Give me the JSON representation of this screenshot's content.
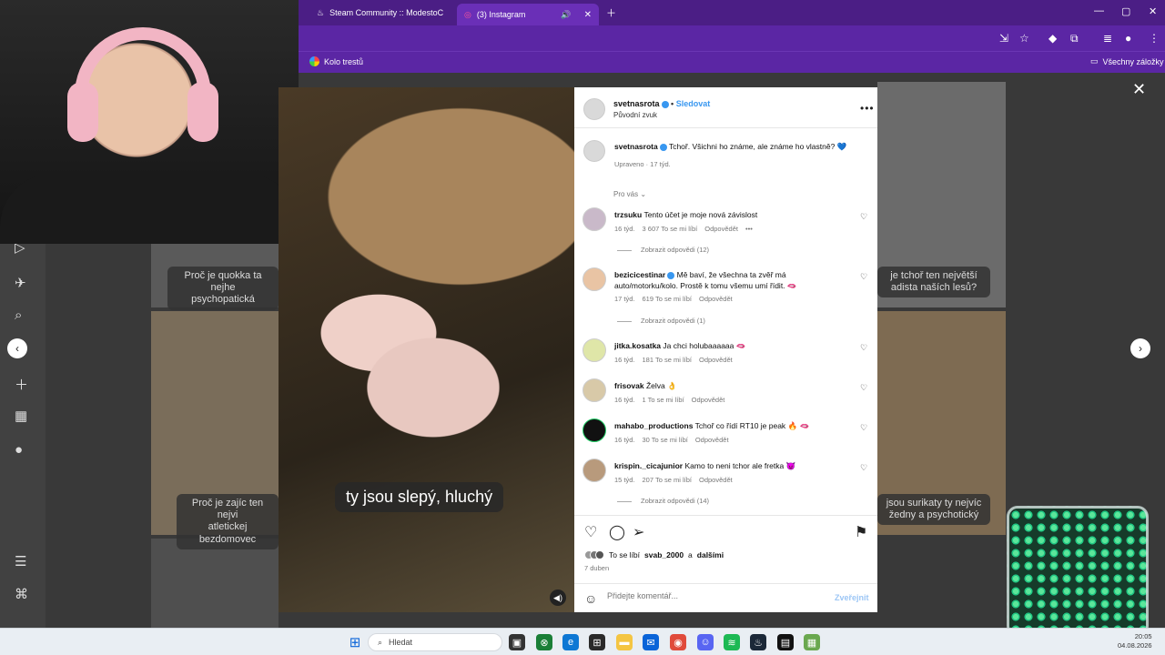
{
  "browser": {
    "tabs": [
      {
        "title": "Steam Community :: ModestoC",
        "icon": "steam-icon",
        "active": false
      },
      {
        "title": "(3) Instagram",
        "icon": "instagram-icon",
        "active": true
      }
    ],
    "bookmarks": [
      {
        "label": "Kolo trestů"
      }
    ],
    "bookmarks_all": "Všechny záložky"
  },
  "backdrop": {
    "captions": [
      "Proč je quokka ta nejhe\npsychopatická",
      "je tchoř ten největší\nadista naších lesů?",
      "Proč je zajíc ten nejvi\natletickej bezdomovec",
      "jsou surikaty ty nejvíc\nžedny a psychotický"
    ]
  },
  "post": {
    "author": "svetnasrota",
    "follow_label": "Sledovat",
    "sub": "Původní zvuk",
    "caption": "Tchoř. Všichni ho známe, ale známe ho vlastně? 💙",
    "caption_meta": "Upraveno · 17 týd.",
    "filter_label": "Pro vás",
    "subtitle": "ty jsou slepý, hluchý",
    "likes_prefix": "To se líbí",
    "likes_user": "svab_2000",
    "likes_and": "a",
    "likes_more": "dalšími",
    "date": "7 duben",
    "comment_placeholder": "Přidejte komentář...",
    "post_label": "Zveřejnit"
  },
  "comments": [
    {
      "user": "trzsuku",
      "text": "Tento účet je moje nová závislost",
      "age": "16 týd.",
      "likes": "3 607 To se mi líbí",
      "reply": "Odpovědět",
      "replies": "Zobrazit odpovědi (12)"
    },
    {
      "user": "bezicicestinar",
      "text": "Mě baví, že všechna ta zvěř má auto/motorku/kolo. Prostě k tomu všemu umí řídit. 🫦",
      "age": "17 týd.",
      "likes": "619 To se mi líbí",
      "reply": "Odpovědět",
      "replies": "Zobrazit odpovědi (1)"
    },
    {
      "user": "jitka.kosatka",
      "text": "Ja chci holubaaaaaa 🫦",
      "age": "16 týd.",
      "likes": "181 To se mi líbí",
      "reply": "Odpovědět",
      "replies": ""
    },
    {
      "user": "frisovak",
      "text": "Želva 👌",
      "age": "16 týd.",
      "likes": "1 To se mi líbí",
      "reply": "Odpovědět",
      "replies": ""
    },
    {
      "user": "mahabo_productions",
      "text": "Tchoř co řídí RT10 je peak 🔥 🫦",
      "age": "16 týd.",
      "likes": "30 To se mi líbí",
      "reply": "Odpovědět",
      "replies": ""
    },
    {
      "user": "krispin._cicajunior",
      "text": "Kamo to neni tchor ale fretka 😈",
      "age": "15 týd.",
      "likes": "207 To se mi líbí",
      "reply": "Odpovědět",
      "replies": "Zobrazit odpovědi (14)"
    }
  ],
  "taskbar": {
    "search_placeholder": "Hledat",
    "time": "20:05",
    "date": "04.08.2026"
  },
  "colors": {
    "accent": "#5b26a4",
    "ig_blue": "#3897f0"
  }
}
